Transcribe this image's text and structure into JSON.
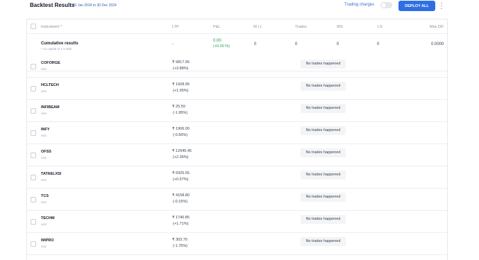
{
  "header": {
    "title": "Backtest Results",
    "date_range": "01 Jan 2024 to 30 Dec 2024",
    "trading_charges_label": "Trading charges",
    "deploy_label": "DEPLOY ALL",
    "more_icon": "kebab-menu-icon"
  },
  "colors": {
    "accent": "#2f6fe4",
    "positive": "#22a04b"
  },
  "table": {
    "columns": [
      "Instrument ^",
      "LTP",
      "P&L",
      "W | L",
      "Trades",
      "WS",
      "LS",
      "Max DD"
    ],
    "cumulative": {
      "label": "Cumulative results",
      "sublabel": "* on capital of 1.5 lakh",
      "ltp": "-",
      "pnl": "0.00",
      "pnl_pct": "(+0.00 %)",
      "wl": "0",
      "trades": "0",
      "ws": "0",
      "ls": "0",
      "max_dd": "0.0000"
    },
    "rows": [
      {
        "symbol": "COFORGE",
        "exchange": "NSE",
        "ltp": "₹ 9817.95",
        "change": "(+3.88%)",
        "status": "No trades happened"
      },
      {
        "symbol": "HCLTECH",
        "exchange": "NSE",
        "ltp": "₹ 1928.95",
        "change": "(+1.95%)",
        "status": "No trades happened"
      },
      {
        "symbol": "INFIBEAM",
        "exchange": "NSE",
        "ltp": "₹ 25.59",
        "change": "(-1.95%)",
        "status": "No trades happened"
      },
      {
        "symbol": "INFY",
        "exchange": "NSE",
        "ltp": "₹ 1906.00",
        "change": "(-0.56%)",
        "status": "No trades happened"
      },
      {
        "symbol": "OFSS",
        "exchange": "NSE",
        "ltp": "₹ 12945.45",
        "change": "(+2.36%)",
        "status": "No trades happened"
      },
      {
        "symbol": "TATAELXSI",
        "exchange": "NSE",
        "ltp": "₹ 6925.55",
        "change": "(+0.57%)",
        "status": "No trades happened"
      },
      {
        "symbol": "TCS",
        "exchange": "NSE",
        "ltp": "₹ 4158.80",
        "change": "(-0.15%)",
        "status": "No trades happened"
      },
      {
        "symbol": "TECHM",
        "exchange": "NSE",
        "ltp": "₹ 1740.85",
        "change": "(+1.71%)",
        "status": "No trades happened"
      },
      {
        "symbol": "WIPRO",
        "exchange": "NSE",
        "ltp": "₹ 303.70",
        "change": "(-1.75%)",
        "status": "No trades happened"
      }
    ]
  }
}
